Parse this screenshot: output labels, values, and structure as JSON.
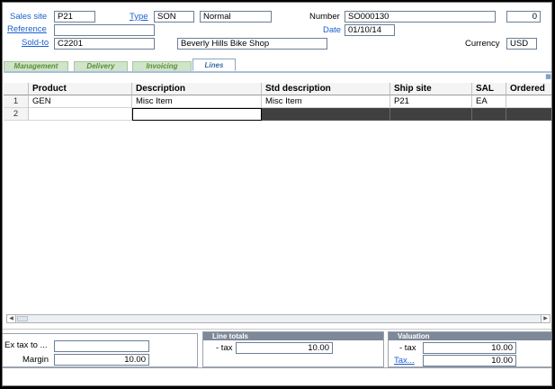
{
  "header": {
    "sales_site_label": "Sales site",
    "sales_site_value": "P21",
    "type_label": "Type",
    "type_code": "SON",
    "type_desc": "Normal",
    "number_label": "Number",
    "number_value": "SO000130",
    "number_counter": "0",
    "reference_label": "Reference",
    "reference_value": "",
    "date_label": "Date",
    "date_value": "01/10/14",
    "soldto_label": "Sold-to",
    "soldto_code": "C2201",
    "soldto_name": "Beverly Hills Bike Shop",
    "currency_label": "Currency",
    "currency_value": "USD"
  },
  "tabs": [
    {
      "label": "Management",
      "active": false
    },
    {
      "label": "Delivery",
      "active": false
    },
    {
      "label": "Invoicing",
      "active": false
    },
    {
      "label": "Lines",
      "active": true
    }
  ],
  "grid": {
    "columns": [
      "Product",
      "Description",
      "Std description",
      "Ship site",
      "SAL",
      "Ordered"
    ],
    "rows": [
      {
        "num": "1",
        "cells": [
          "GEN",
          "Misc Item",
          "Misc Item",
          "P21",
          "EA",
          ""
        ]
      },
      {
        "num": "2",
        "cells": [
          "",
          "",
          "",
          "",
          "",
          ""
        ]
      }
    ]
  },
  "footer": {
    "ex_tax_label": "Ex tax to ...",
    "ex_tax_value": "",
    "margin_label": "Margin",
    "margin_value": "10.00",
    "line_totals_title": "Line totals",
    "line_totals_tax_label": "- tax",
    "line_totals_tax_value": "10.00",
    "valuation_title": "Valuation",
    "valuation_tax_label": "- tax",
    "valuation_tax_value": "10.00",
    "valuation_tax_link_label": "Tax...",
    "valuation_tax_total": "10.00"
  },
  "colors": {
    "link_blue": "#1a5fd0",
    "tab_green": "#5b8f3a",
    "edit_row_dark": "#404040",
    "panel_title": "#7d8898"
  },
  "icons": {
    "corner": "expand-icon",
    "scroll_left": "scroll-left-icon",
    "scroll_right": "scroll-right-icon"
  }
}
